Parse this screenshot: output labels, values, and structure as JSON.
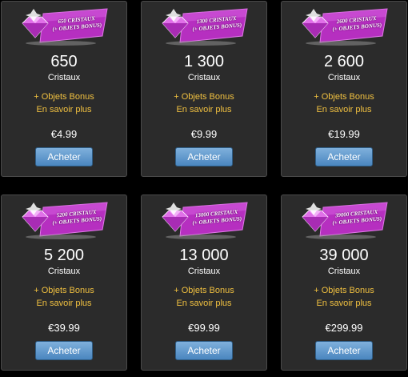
{
  "offers": [
    {
      "banner_line1": "650 CRISTAUX",
      "banner_line2": "(+ OBJETS BONUS)",
      "amount": "650",
      "unit": "Cristaux",
      "bonus": "+ Objets Bonus",
      "more": "En savoir plus",
      "price": "€4.99",
      "button": "Acheter"
    },
    {
      "banner_line1": "1300 CRISTAUX",
      "banner_line2": "(+ OBJETS BONUS)",
      "amount": "1 300",
      "unit": "Cristaux",
      "bonus": "+ Objets Bonus",
      "more": "En savoir plus",
      "price": "€9.99",
      "button": "Acheter"
    },
    {
      "banner_line1": "2600 CRISTAUX",
      "banner_line2": "(+ OBJETS BONUS)",
      "amount": "2 600",
      "unit": "Cristaux",
      "bonus": "+ Objets Bonus",
      "more": "En savoir plus",
      "price": "€19.99",
      "button": "Acheter"
    },
    {
      "banner_line1": "5200 CRISTAUX",
      "banner_line2": "(+ OBJETS BONUS)",
      "amount": "5 200",
      "unit": "Cristaux",
      "bonus": "+ Objets Bonus",
      "more": "En savoir plus",
      "price": "€39.99",
      "button": "Acheter"
    },
    {
      "banner_line1": "13000 CRISTAUX",
      "banner_line2": "(+ OBJETS BONUS)",
      "amount": "13 000",
      "unit": "Cristaux",
      "bonus": "+ Objets Bonus",
      "more": "En savoir plus",
      "price": "€99.99",
      "button": "Acheter"
    },
    {
      "banner_line1": "39000 CRISTAUX",
      "banner_line2": "(+ OBJETS BONUS)",
      "amount": "39 000",
      "unit": "Cristaux",
      "bonus": "+ Objets Bonus",
      "more": "En savoir plus",
      "price": "€299.99",
      "button": "Acheter"
    }
  ],
  "icons": {
    "banner": "purple-gem-banner-icon"
  },
  "colors": {
    "background": "#000000",
    "card": "#2b2b2b",
    "accent_text": "#f0c040",
    "button": "#5b95c8",
    "banner": "#b62fc0"
  }
}
